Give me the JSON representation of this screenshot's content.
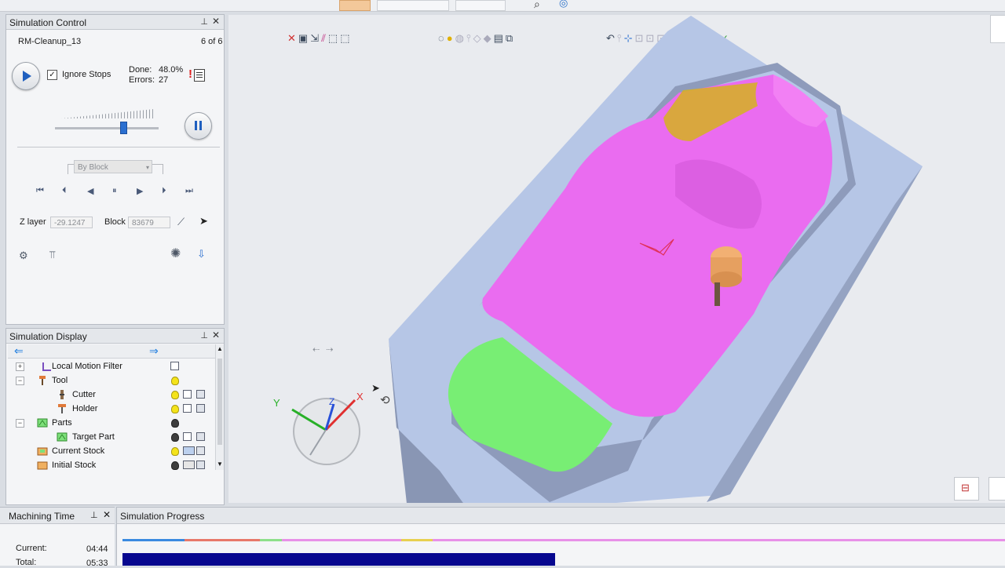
{
  "colors": {
    "accent": "#1f5fbf",
    "part_magenta": "#ea6cf0",
    "stock_blue": "#b9c8e6",
    "green_part": "#7cf07a",
    "progress_navy": "#07078f"
  },
  "sim_control": {
    "title": "Simulation Control",
    "pin_icon": "pin-icon",
    "close_icon": "close-icon",
    "toolpath_name": "RM-Cleanup_13",
    "counter": "6 of 6",
    "ignore_stops_label": "Ignore Stops",
    "ignore_stops_checked": true,
    "done_label": "Done:",
    "done_value": "48.0%",
    "errors_label": "Errors:",
    "errors_value": "27",
    "speed_level": 0.66,
    "step_mode": "By Block",
    "zlayer_label": "Z layer",
    "zlayer_value": "-29.1247",
    "block_label": "Block",
    "block_value": "83679"
  },
  "sim_display": {
    "title": "Simulation Display",
    "tree": [
      {
        "label": "Local Motion Filter",
        "expand": "+"
      },
      {
        "label": "Tool",
        "expand": "−"
      },
      {
        "label": "Cutter",
        "expand": ""
      },
      {
        "label": "Holder",
        "expand": ""
      },
      {
        "label": "Parts",
        "expand": "−"
      },
      {
        "label": "Target Part",
        "expand": ""
      },
      {
        "label": "Current Stock",
        "expand": ""
      },
      {
        "label": "Initial Stock",
        "expand": ""
      }
    ]
  },
  "axis": {
    "x": "X",
    "y": "Y",
    "z": "Z"
  },
  "machining_time": {
    "title": "Machining Time",
    "current_label": "Current:",
    "current_value": "04:44",
    "total_label": "Total:",
    "total_value": "05:33"
  },
  "sim_progress": {
    "title": "Simulation Progress",
    "progress_fraction": 0.49
  }
}
